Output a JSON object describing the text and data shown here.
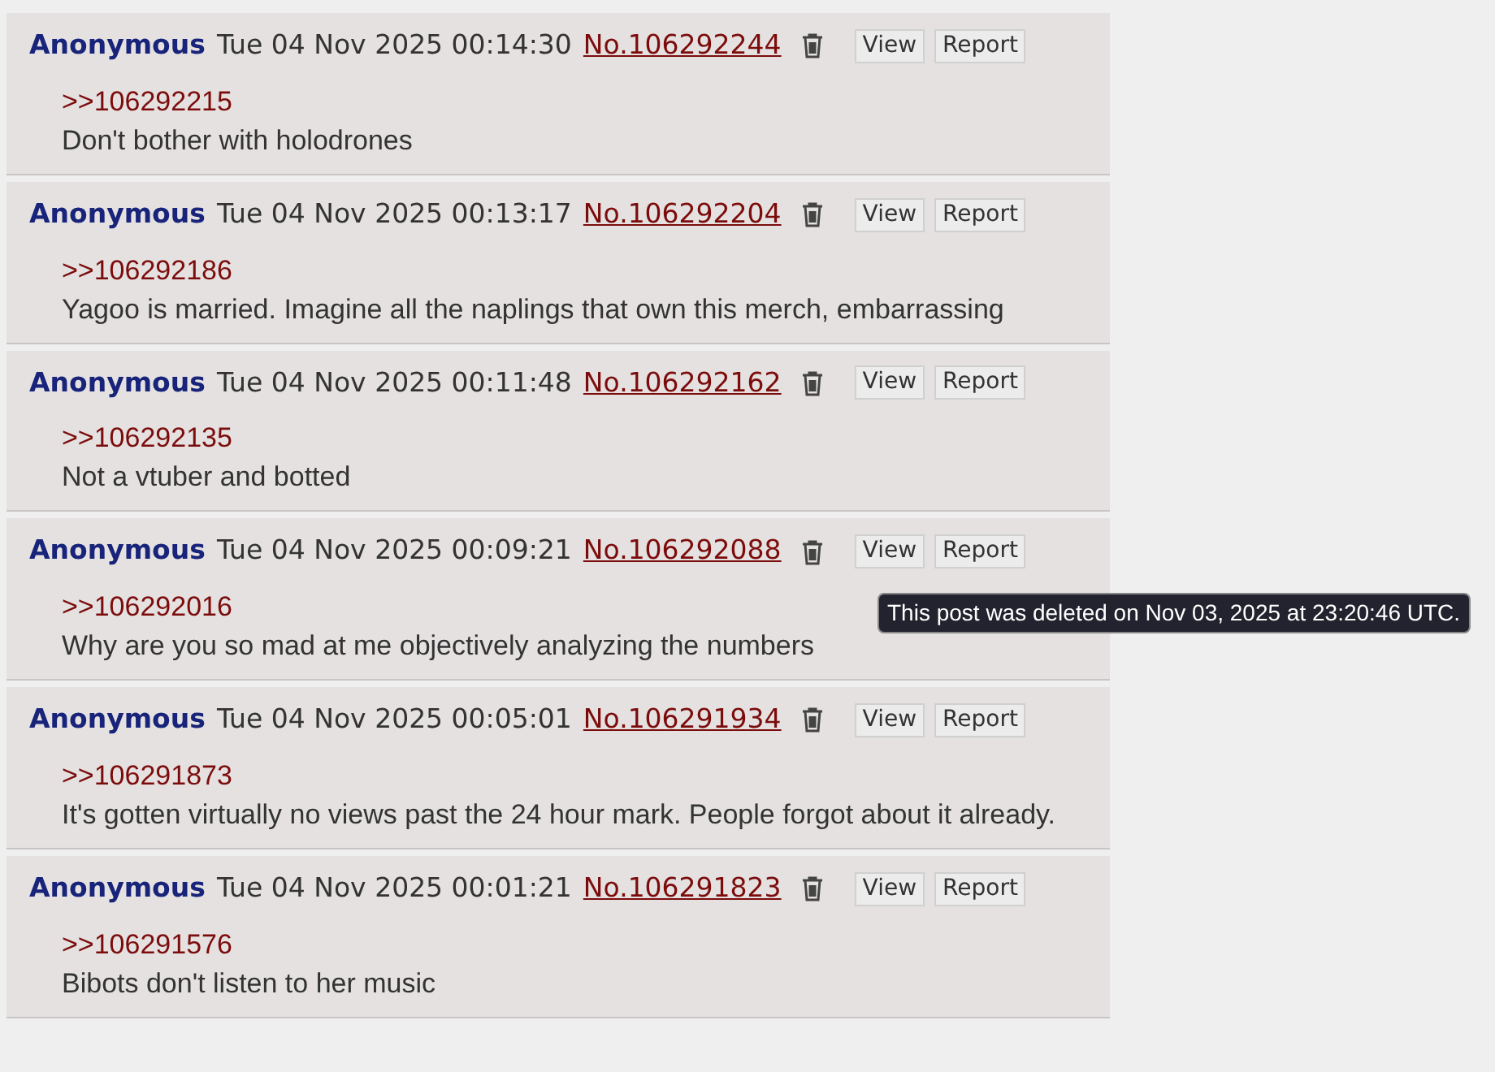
{
  "posts": [
    {
      "name": "Anonymous",
      "datetime": "Tue 04 Nov 2025 00:14:30",
      "number": "No.106292244",
      "view": "View",
      "report": "Report",
      "quote": ">>106292215",
      "text": "Don't bother with holodrones"
    },
    {
      "name": "Anonymous",
      "datetime": "Tue 04 Nov 2025 00:13:17",
      "number": "No.106292204",
      "view": "View",
      "report": "Report",
      "quote": ">>106292186",
      "text": "Yagoo is married. Imagine all the naplings that own this merch, embarrassing"
    },
    {
      "name": "Anonymous",
      "datetime": "Tue 04 Nov 2025 00:11:48",
      "number": "No.106292162",
      "view": "View",
      "report": "Report",
      "quote": ">>106292135",
      "text": "Not a vtuber and botted"
    },
    {
      "name": "Anonymous",
      "datetime": "Tue 04 Nov 2025 00:09:21",
      "number": "No.106292088",
      "view": "View",
      "report": "Report",
      "quote": ">>106292016",
      "text": "Why are you so mad at me objectively analyzing the numbers",
      "tooltip": "This post was deleted on Nov 03, 2025 at 23:20:46 UTC."
    },
    {
      "name": "Anonymous",
      "datetime": "Tue 04 Nov 2025 00:05:01",
      "number": "No.106291934",
      "view": "View",
      "report": "Report",
      "quote": ">>106291873",
      "text": "It's gotten virtually no views past the 24 hour mark. People forgot about it already."
    },
    {
      "name": "Anonymous",
      "datetime": "Tue 04 Nov 2025 00:01:21",
      "number": "No.106291823",
      "view": "View",
      "report": "Report",
      "quote": ">>106291576",
      "text": "Bibots don't listen to her music"
    }
  ]
}
